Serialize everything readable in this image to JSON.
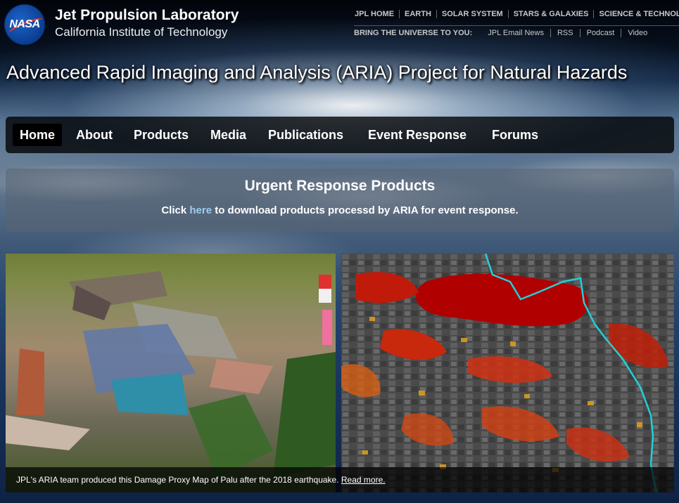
{
  "header": {
    "logo_text": "NASA",
    "lab_title": "Jet Propulsion Laboratory",
    "lab_subtitle": "California Institute of Technology",
    "top_links": [
      "JPL HOME",
      "EARTH",
      "SOLAR SYSTEM",
      "STARS & GALAXIES",
      "SCIENCE & TECHNOLOGY"
    ],
    "bring_label": "BRING THE UNIVERSE TO YOU:",
    "bring_links": [
      "JPL Email News",
      "RSS",
      "Podcast",
      "Video"
    ]
  },
  "project_title": "Advanced Rapid Imaging and Analysis (ARIA) Project for Natural Hazards",
  "nav": {
    "items": [
      "Home",
      "About",
      "Products",
      "Media",
      "Publications",
      "Event Response",
      "Forums"
    ],
    "active": "Home"
  },
  "urgent": {
    "heading": "Urgent Response Products",
    "text_before": "Click ",
    "link_text": "here",
    "text_after": " to download products processd by ARIA for event response."
  },
  "slideshow": {
    "caption": "JPL's ARIA team produced this Damage Proxy Map of Palu after the 2018 earthquake. ",
    "read_more": "Read more."
  },
  "colors": {
    "nav_bg": "#000000",
    "link": "#9ecdf0",
    "damage_red": "#b00000",
    "damage_orange": "#e06010",
    "damage_yellow": "#d8c020",
    "fault_line": "#20d0d8"
  }
}
